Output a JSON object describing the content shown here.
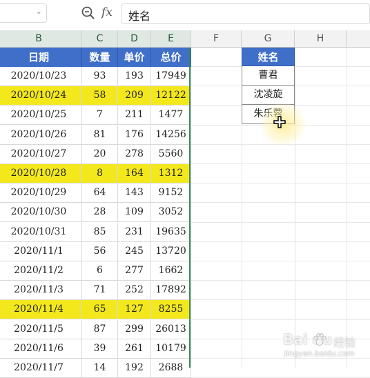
{
  "formula_bar": {
    "namebox_value": "",
    "fx_label": "fx",
    "content": "姓名"
  },
  "column_headers": [
    "B",
    "C",
    "D",
    "E",
    "F",
    "G",
    "H"
  ],
  "table": {
    "headers": [
      "日期",
      "数量",
      "单价",
      "总价"
    ],
    "rows": [
      {
        "date": "2020/10/23",
        "qty": "93",
        "price": "193",
        "total": "17949",
        "highlight": false
      },
      {
        "date": "2020/10/24",
        "qty": "58",
        "price": "209",
        "total": "12122",
        "highlight": true
      },
      {
        "date": "2020/10/25",
        "qty": "7",
        "price": "211",
        "total": "1477",
        "highlight": false
      },
      {
        "date": "2020/10/26",
        "qty": "81",
        "price": "176",
        "total": "14256",
        "highlight": false
      },
      {
        "date": "2020/10/27",
        "qty": "20",
        "price": "278",
        "total": "5560",
        "highlight": false
      },
      {
        "date": "2020/10/28",
        "qty": "8",
        "price": "164",
        "total": "1312",
        "highlight": true
      },
      {
        "date": "2020/10/29",
        "qty": "64",
        "price": "143",
        "total": "9152",
        "highlight": false
      },
      {
        "date": "2020/10/30",
        "qty": "28",
        "price": "109",
        "total": "3052",
        "highlight": false
      },
      {
        "date": "2020/10/31",
        "qty": "85",
        "price": "231",
        "total": "19635",
        "highlight": false
      },
      {
        "date": "2020/11/1",
        "qty": "56",
        "price": "245",
        "total": "13720",
        "highlight": false
      },
      {
        "date": "2020/11/2",
        "qty": "6",
        "price": "277",
        "total": "1662",
        "highlight": false
      },
      {
        "date": "2020/11/3",
        "qty": "71",
        "price": "252",
        "total": "17892",
        "highlight": false
      },
      {
        "date": "2020/11/4",
        "qty": "65",
        "price": "127",
        "total": "8255",
        "highlight": true
      },
      {
        "date": "2020/11/5",
        "qty": "87",
        "price": "299",
        "total": "26013",
        "highlight": false
      },
      {
        "date": "2020/11/6",
        "qty": "39",
        "price": "261",
        "total": "10179",
        "highlight": false
      },
      {
        "date": "2020/11/7",
        "qty": "14",
        "price": "192",
        "total": "2688",
        "highlight": false
      }
    ]
  },
  "name_table": {
    "header": "姓名",
    "names": [
      "曹君",
      "沈凌旋",
      "朱乐蓉"
    ]
  },
  "colors": {
    "header_blue": "#3f6fc9",
    "highlight_yellow": "#f3e81c",
    "selection_green": "#3a8a5c"
  },
  "watermark": {
    "brand": "Bai  du",
    "cn": "经验",
    "url": "jingyan.baidu.com"
  }
}
